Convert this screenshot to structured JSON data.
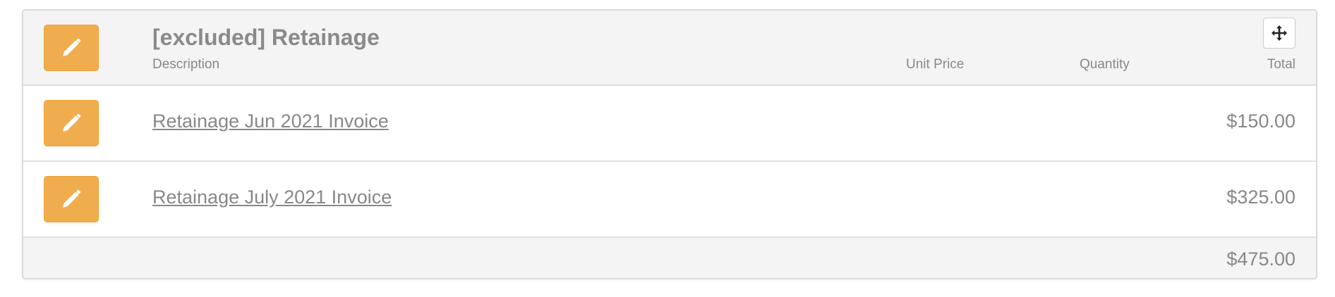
{
  "section": {
    "title": "[excluded] Retainage",
    "columns": {
      "description": "Description",
      "unit_price": "Unit Price",
      "quantity": "Quantity",
      "total": "Total"
    },
    "edit_icon": "pencil-icon",
    "move_icon": "arrows-move-icon"
  },
  "items": [
    {
      "description": "Retainage Jun 2021 Invoice",
      "total": "$150.00"
    },
    {
      "description": "Retainage July 2021 Invoice",
      "total": "$325.00"
    }
  ],
  "footer": {
    "grand_total": "$475.00"
  },
  "colors": {
    "edit_button": "#f0ad4e",
    "header_bg": "#f4f4f4",
    "text": "#888888"
  }
}
